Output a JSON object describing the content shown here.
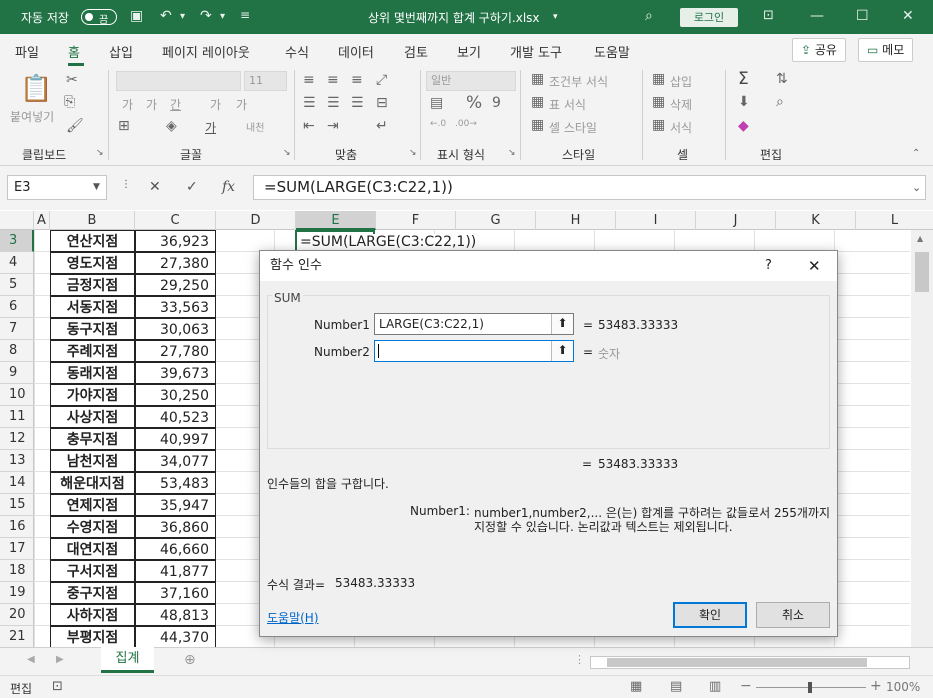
{
  "titlebar": {
    "autosave_label": "자동 저장",
    "autosave_state": "끔",
    "filename": "상위 몇번째까지 합계 구하기.xlsx",
    "login": "로그인"
  },
  "ribbon_tabs": [
    "파일",
    "홈",
    "삽입",
    "페이지 레이아웃",
    "수식",
    "데이터",
    "검토",
    "보기",
    "개발 도구",
    "도움말"
  ],
  "share_label": "공유",
  "memo_label": "메모",
  "ribbon": {
    "groups": [
      "클립보드",
      "글꼴",
      "맞춤",
      "표시 형식",
      "스타일",
      "셀",
      "편집"
    ],
    "paste_label": "붙여넣기",
    "font_size": "11",
    "number_format": "일반",
    "cond_format": "조건부 서식",
    "table_format": "표 서식",
    "cell_style": "셀 스타일",
    "insert": "삽입",
    "delete": "삭제",
    "format": "서식"
  },
  "formula_bar": {
    "name_box": "E3",
    "formula": "=SUM(LARGE(C3:C22,1))"
  },
  "columns": [
    "A",
    "B",
    "C",
    "D",
    "E",
    "F",
    "G",
    "H",
    "I",
    "J",
    "K",
    "L"
  ],
  "rows": [
    "3",
    "4",
    "5",
    "6",
    "7",
    "8",
    "9",
    "10",
    "11",
    "12",
    "13",
    "14",
    "15",
    "16",
    "17",
    "18",
    "19",
    "20",
    "21"
  ],
  "table": [
    {
      "name": "연산지점",
      "value": "36,923"
    },
    {
      "name": "영도지점",
      "value": "27,380"
    },
    {
      "name": "금정지점",
      "value": "29,250"
    },
    {
      "name": "서동지점",
      "value": "33,563"
    },
    {
      "name": "동구지점",
      "value": "30,063"
    },
    {
      "name": "주례지점",
      "value": "27,780"
    },
    {
      "name": "동래지점",
      "value": "39,673"
    },
    {
      "name": "가야지점",
      "value": "30,250"
    },
    {
      "name": "사상지점",
      "value": "40,523"
    },
    {
      "name": "충무지점",
      "value": "40,997"
    },
    {
      "name": "남천지점",
      "value": "34,077"
    },
    {
      "name": "해운대지점",
      "value": "53,483"
    },
    {
      "name": "연제지점",
      "value": "35,947"
    },
    {
      "name": "수영지점",
      "value": "36,860"
    },
    {
      "name": "대연지점",
      "value": "46,660"
    },
    {
      "name": "구서지점",
      "value": "41,877"
    },
    {
      "name": "중구지점",
      "value": "37,160"
    },
    {
      "name": "사하지점",
      "value": "48,813"
    },
    {
      "name": "부평지점",
      "value": "44,370"
    }
  ],
  "active_cell_text": "=SUM(LARGE(C3:C22,1))",
  "sheet_tab": "집계",
  "status": {
    "mode": "편집",
    "zoom": "100%"
  },
  "dialog": {
    "title": "함수 인수",
    "help_q": "?",
    "function_name": "SUM",
    "arg1_label": "Number1",
    "arg1_value": "LARGE(C3:C22,1)",
    "arg1_result": "53483.33333",
    "arg2_label": "Number2",
    "arg2_value": "",
    "arg2_result": "숫자",
    "eq": "=",
    "total_result": "53483.33333",
    "description": "인수들의 합을 구합니다.",
    "arg_help_label": "Number1:",
    "arg_help_line1": "number1,number2,... 은(는) 합계를 구하려는 값들로서 255개까지",
    "arg_help_line2": "지정할 수 있습니다. 논리값과 텍스트는 제외됩니다.",
    "formula_result_label": "수식 결과=",
    "formula_result_value": "53483.33333",
    "help_link": "도움말(H)",
    "ok": "확인",
    "cancel": "취소"
  },
  "colors": {
    "excel_green": "#217346",
    "dialog_focus": "#0078d7"
  }
}
